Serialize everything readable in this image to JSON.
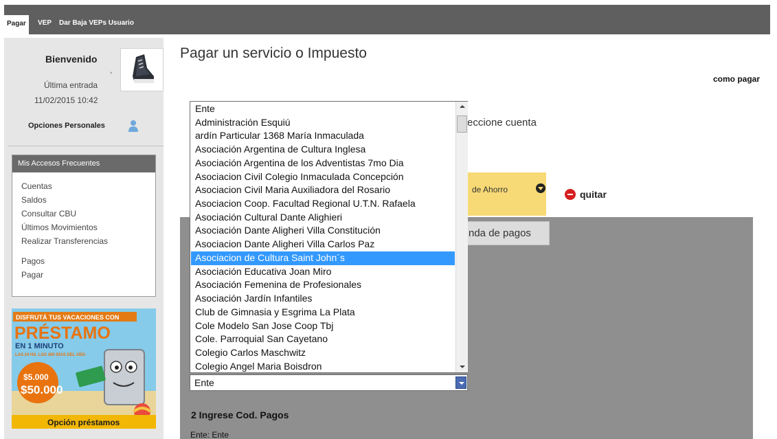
{
  "tabs": [
    {
      "label": "Pagar",
      "active": true
    },
    {
      "label": "VEP",
      "active": false
    },
    {
      "label": "Dar Baja VEPs Usuario",
      "active": false
    }
  ],
  "sidebar": {
    "welcome": "Bienvenido",
    "comma": ",",
    "last_entry_label": "Última entrada",
    "last_entry_date": "11/02/2015 10:42",
    "personal_options": "Opciones Personales",
    "frequent": {
      "title": "Mis Accesos Frecuentes",
      "group1": [
        "Cuentas",
        "Saldos",
        "Consultar CBU",
        "Últimos Movimientos",
        "Realizar Transferencias"
      ],
      "group2": [
        "Pagos",
        "Pagar"
      ]
    },
    "promo": {
      "line1": "DISFRUTÁ TUS VACACIONES CON",
      "line2": "PRÉSTAMO",
      "line3": "EN 1 MINUTO",
      "line4": "LAS 24 HS. LOS 365 DÍAS DEL AÑO",
      "amount_from": "$5.000",
      "amount_to": "$50.000",
      "cta": "Opción préstamos"
    }
  },
  "main": {
    "title": "Pagar un servicio o Impuesto",
    "how_to_pay": "como pagar",
    "partial_select_account": "eccione cuenta",
    "account_partial": "de Ahorro",
    "remove_label": "quitar",
    "agenda_button": "nda de pagos",
    "step2_title": "2 Ingrese Cod. Pagos",
    "ente_line": "Ente: Ente"
  },
  "dropdown": {
    "selected_value": "Ente",
    "highlighted_index": 11,
    "options": [
      "Ente",
      "Administración Esquiú",
      "ardín Particular 1368 María Inmaculada",
      "Asociación Argentina de Cultura Inglesa",
      "Asociación Argentina de los Adventistas 7mo Dia",
      "Asociacion Civil Colegio Inmaculada Concepción",
      "Asociacion Civil Maria Auxiliadora del Rosario",
      "Asociacion Coop. Facultad Regional U.T.N. Rafaela",
      "Asociación Cultural Dante Alighieri",
      "Asociación Dante Aligheri Villa Constitución",
      "Asociacion Dante Aligheri Villa Carlos Paz",
      "Asociacion de Cultura Saint John´s",
      "Asociación Educativa Joan Miro",
      "Asociación Femenina de Profesionales",
      "Asociación Jardín Infantiles",
      "Club de Gimnasia y Esgrima La Plata",
      "Cole Modelo San Jose Coop Tbj",
      "Cole. Parroquial San Cayetano",
      "Colegio Carlos Maschwitz",
      "Colegio Angel Maria Boisdron"
    ]
  },
  "colors": {
    "top_bar": "#5f5f5f",
    "sidebar_bg": "#e6e6e6",
    "highlight": "#3399ff",
    "account_yellow": "#f7da76",
    "panel_grey": "#8f8f8f",
    "remove_red": "#d61e1e"
  },
  "icons": [
    "sneaker-avatar-icon",
    "person-icon",
    "dropdown-arrow-icon",
    "remove-icon",
    "scroll-up-icon",
    "scroll-down-icon"
  ]
}
